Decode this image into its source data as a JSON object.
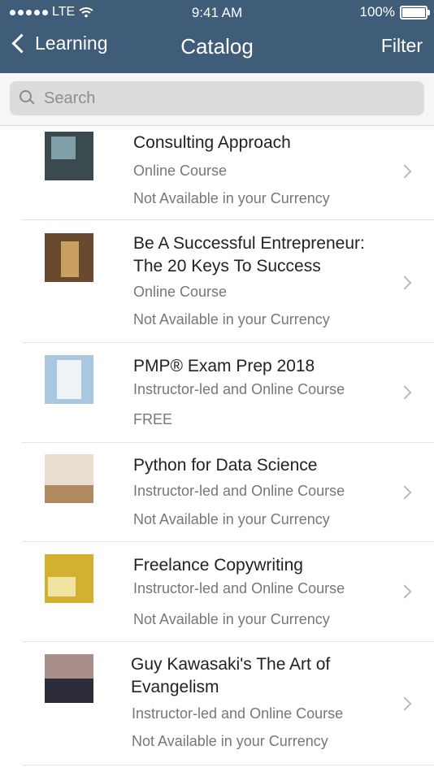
{
  "status": {
    "carrier": "LTE",
    "time": "9:41 AM",
    "battery": "100%"
  },
  "nav": {
    "back_label": "Learning",
    "title": "Catalog",
    "filter_label": "Filter"
  },
  "search": {
    "placeholder": "Search"
  },
  "courses": [
    {
      "title_lines": [
        "Consulting Approach"
      ],
      "type": "Online Course",
      "price": "Not Available in your Currency",
      "thumb_colors": [
        "#3a4a4f",
        "#7fa0a8"
      ]
    },
    {
      "title_lines": [
        "Be A Successful Entrepreneur:",
        "The 20 Keys To Success"
      ],
      "type": "Online Course",
      "price": "Not Available in your Currency",
      "thumb_colors": [
        "#6a4a2e",
        "#c9a060"
      ]
    },
    {
      "title_lines": [
        "PMP® Exam Prep 2018"
      ],
      "type": "Instructor-led and Online Course",
      "price": "FREE",
      "thumb_colors": [
        "#a9c8e0",
        "#eef3f6"
      ]
    },
    {
      "title_lines": [
        "Python for Data Science"
      ],
      "type": "Instructor-led and Online Course",
      "price": "Not Available in your Currency",
      "thumb_colors": [
        "#b08a5e",
        "#e8ddcf"
      ]
    },
    {
      "title_lines": [
        "Freelance Copywriting"
      ],
      "type": "Instructor-led and Online Course",
      "price": "Not Available in your Currency",
      "thumb_colors": [
        "#d2b030",
        "#f0e3a0"
      ]
    },
    {
      "title_lines": [
        "Guy Kawasaki's The Art of",
        "Evangelism"
      ],
      "type": "Instructor-led and Online Course",
      "price": "Not Available in your Currency",
      "thumb_colors": [
        "#2c2d38",
        "#a98f8a"
      ]
    }
  ]
}
